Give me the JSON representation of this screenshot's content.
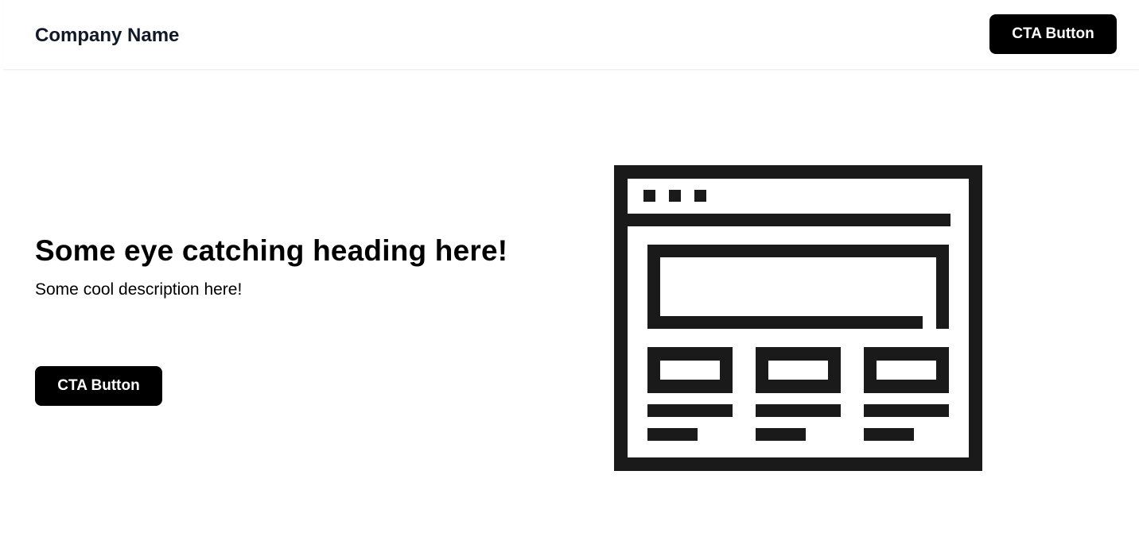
{
  "header": {
    "brand": "Company Name",
    "cta_label": "CTA Button"
  },
  "hero": {
    "heading": "Some eye catching heading here!",
    "description": "Some cool description here!",
    "cta_label": "CTA Button"
  },
  "illustration": {
    "icon": "website-wireframe-icon",
    "stroke_color": "#1a1a1a"
  },
  "colors": {
    "background": "#ffffff",
    "button_bg": "#000000",
    "button_text": "#ffffff",
    "brand_text": "#111827"
  }
}
